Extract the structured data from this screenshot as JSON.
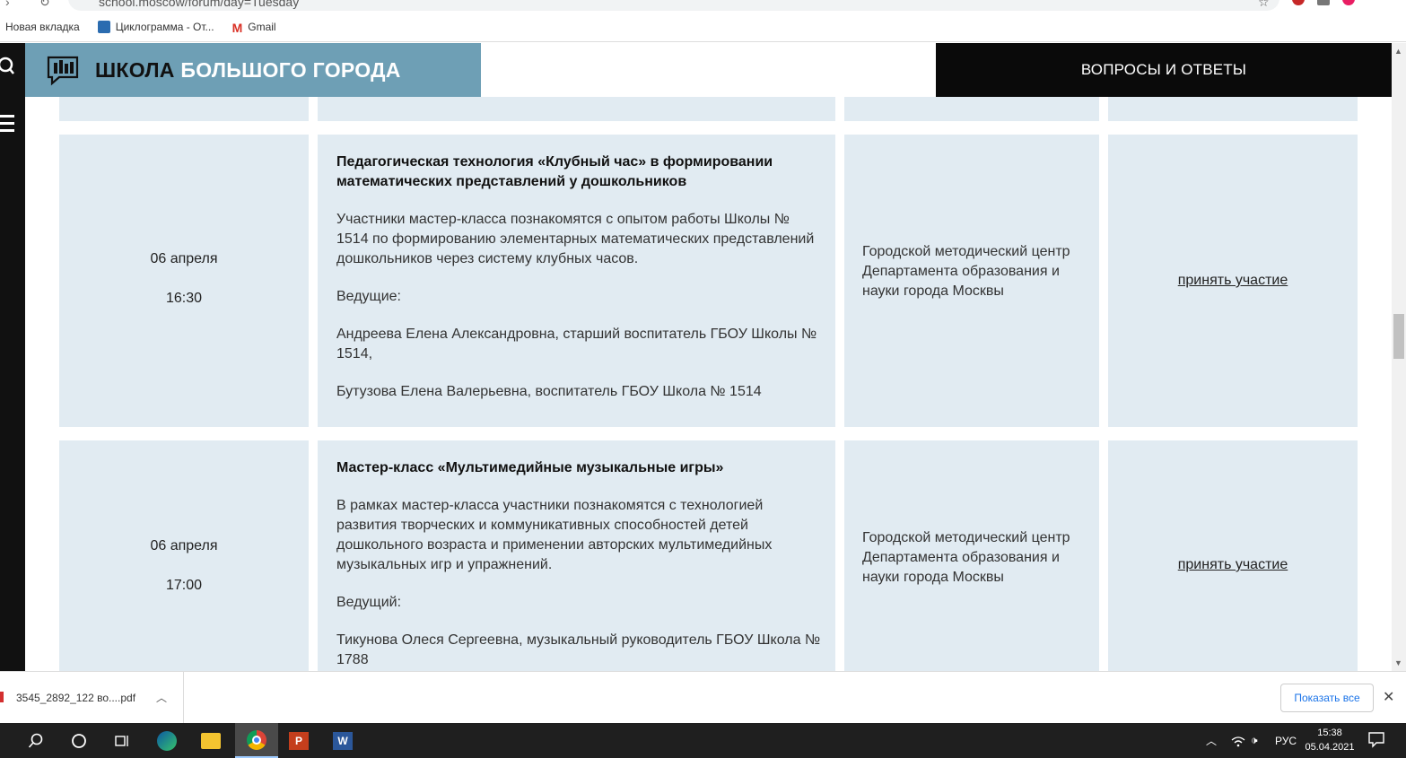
{
  "browser": {
    "url": "school.moscow/forum/day=Tuesday",
    "bookmarks": [
      {
        "label": "Новая вкладка"
      },
      {
        "label": "Циклограмма - От..."
      },
      {
        "label": "Gmail"
      }
    ]
  },
  "site": {
    "brand_dark": "ШКОЛА",
    "brand_light": "БОЛЬШОГО ГОРОДА",
    "faq_label": "ВОПРОСЫ И ОТВЕТЫ"
  },
  "events": [
    {
      "date": "06 апреля",
      "time": "16:30",
      "title": "Педагогическая технология «Клубный час» в формировании математических представлений у дошкольников",
      "description": "Участники мастер-класса познакомятся с опытом работы Школы № 1514 по формированию элементарных математических представлений дошкольников через систему клубных часов.",
      "hosts_label": "Ведущие:",
      "host_1": "Андреева Елена Александровна, старший воспитатель ГБОУ Школы № 1514,",
      "host_2": "Бутузова Елена Валерьевна, воспитатель ГБОУ Школа № 1514",
      "organizer": "Городской методический центр Департамента образования и науки города Москвы",
      "action": "принять участие"
    },
    {
      "date": "06 апреля",
      "time": "17:00",
      "title": "Мастер-класс «Мультимедийные музыкальные игры»",
      "description": "В рамках мастер-класса участники познакомятся с технологией развития творческих и коммуникативных способностей детей дошкольного возраста и применении авторских мультимедийных музыкальных игр и упражнений.",
      "hosts_label": "Ведущий:",
      "host_1": "Тикунова Олеся Сергеевна, музыкальный руководитель ГБОУ Школа № 1788",
      "organizer": "Городской методический центр Департамента образования и науки города Москвы",
      "action": "принять участие"
    }
  ],
  "downloads": {
    "file_name": "3545_2892_122 во....pdf",
    "show_all": "Показать все"
  },
  "taskbar": {
    "language": "РУС",
    "time": "15:38",
    "date": "05.04.2021"
  }
}
